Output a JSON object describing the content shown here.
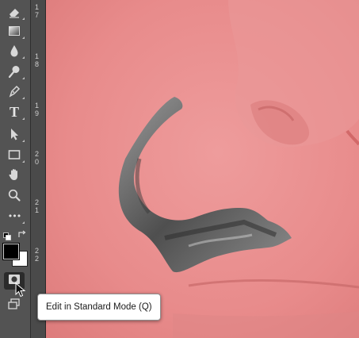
{
  "toolbar": {
    "tools": [
      {
        "id": "eraser",
        "icon": "eraser-icon"
      },
      {
        "id": "gradient",
        "icon": "gradient-icon"
      },
      {
        "id": "blur",
        "icon": "blur-drop-icon"
      },
      {
        "id": "dodge",
        "icon": "dodge-icon"
      },
      {
        "id": "pen",
        "icon": "pen-icon"
      },
      {
        "id": "type",
        "icon": "type-icon",
        "label": "T"
      },
      {
        "id": "path-selection",
        "icon": "path-selection-arrow-icon"
      },
      {
        "id": "rectangle",
        "icon": "rectangle-icon"
      },
      {
        "id": "hand",
        "icon": "hand-icon"
      },
      {
        "id": "zoom",
        "icon": "zoom-icon"
      },
      {
        "id": "edit-toolbar",
        "icon": "more-dots-icon",
        "label": "•••"
      }
    ],
    "foreground_color": "#000000",
    "background_color": "#ffffff",
    "quick_mask_active": true
  },
  "ruler": {
    "labels": [
      "1\n7",
      "1\n8",
      "1\n9",
      "2\n0",
      "2\n1",
      "2\n2"
    ]
  },
  "canvas": {
    "overlay_color": "#e88a8a",
    "mask_description_color": "#5a5a5a"
  },
  "tooltip": {
    "text": "Edit in Standard Mode (Q)"
  }
}
